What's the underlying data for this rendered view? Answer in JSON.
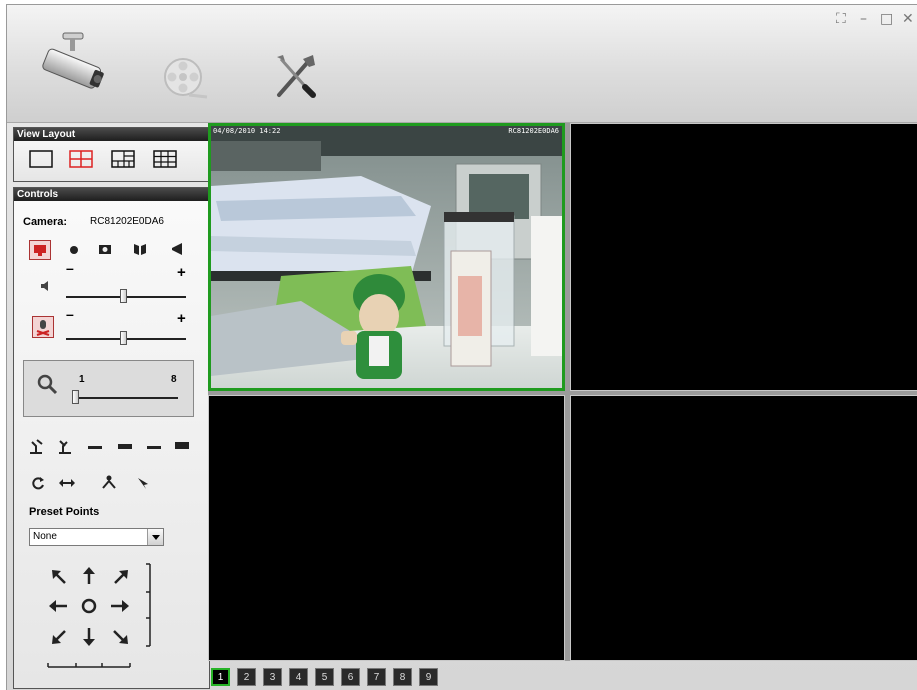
{
  "window_controls": {
    "fullscreen_glyph": "⛶",
    "minimize_glyph": "–",
    "maximize_glyph": "□",
    "close_glyph": "✕"
  },
  "toolbar": {
    "items": [
      {
        "name": "live-view",
        "icon": "security-camera-icon"
      },
      {
        "name": "playback",
        "icon": "film-reel-icon"
      },
      {
        "name": "settings",
        "icon": "tools-icon"
      }
    ]
  },
  "view_layout": {
    "title": "View Layout",
    "options": [
      "1x1",
      "2x2",
      "1+5",
      "3x3"
    ],
    "selected": "2x2"
  },
  "controls": {
    "title": "Controls",
    "camera_label": "Camera:",
    "camera_id": "RC81202E0DA6",
    "volume": {
      "minus": "–",
      "plus": "+",
      "level": 0.5
    },
    "mic": {
      "minus": "–",
      "plus": "+",
      "level": 0.5
    },
    "zoom": {
      "min_label": "1",
      "max_label": "8",
      "value": 1
    },
    "preset_label": "Preset Points",
    "preset_selected": "None",
    "accent_color": "#cc2222"
  },
  "video": {
    "active_border": "#1f9b1f",
    "viewports": [
      {
        "id": 1,
        "timestamp": "04/08/2010 14:22",
        "camera": "RC81202E0DA6",
        "has_feed": true
      },
      {
        "id": 2,
        "timestamp": "",
        "camera": "",
        "has_feed": false
      },
      {
        "id": 3,
        "timestamp": "",
        "camera": "",
        "has_feed": false
      },
      {
        "id": 4,
        "timestamp": "",
        "camera": "",
        "has_feed": false
      }
    ]
  },
  "pages": {
    "items": [
      "1",
      "2",
      "3",
      "4",
      "5",
      "6",
      "7",
      "8",
      "9"
    ],
    "selected": "1"
  }
}
